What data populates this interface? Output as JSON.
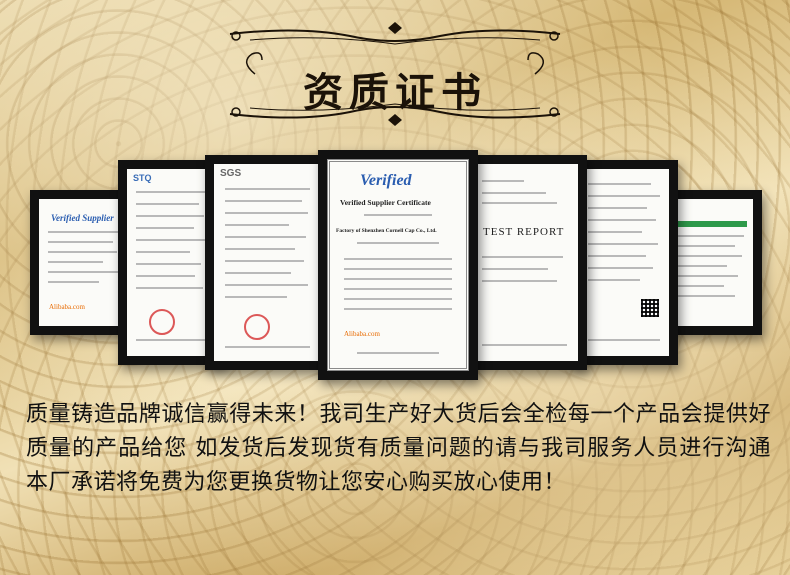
{
  "title": "资质证书",
  "certificates": [
    {
      "id": "c1",
      "header": "",
      "logo_text": "Verified Supplier",
      "brand": "Alibaba.com"
    },
    {
      "id": "c2",
      "header": "STQ",
      "logo_text": "",
      "brand": ""
    },
    {
      "id": "c3",
      "header": "SGS",
      "logo_text": "",
      "brand": ""
    },
    {
      "id": "c4",
      "header": "",
      "logo_text": "Verified",
      "subtitle": "Verified Supplier Certificate",
      "factory": "Factory of Shenzhen Cornell Cap Co., Ltd.",
      "brand": "Alibaba.com"
    },
    {
      "id": "c5",
      "header": "",
      "logo_text": "",
      "report": "TEST REPORT"
    },
    {
      "id": "c6",
      "header": "",
      "logo_text": "",
      "brand": ""
    },
    {
      "id": "c7",
      "header": "",
      "logo_text": "",
      "brand": ""
    }
  ],
  "body_text": "质量铸造品牌诚信赢得未来！我司生产好大货后会全检每一个产品会提供好质量的产品给您 如发货后发现货有质量问题的请与我司服务人员进行沟通本厂承诺将免费为您更换货物让您安心购买放心使用！",
  "colors": {
    "background_gold": "#d6b876",
    "title_text": "#1b1208",
    "frame": "#111111",
    "verified_blue": "#2a5db0"
  }
}
